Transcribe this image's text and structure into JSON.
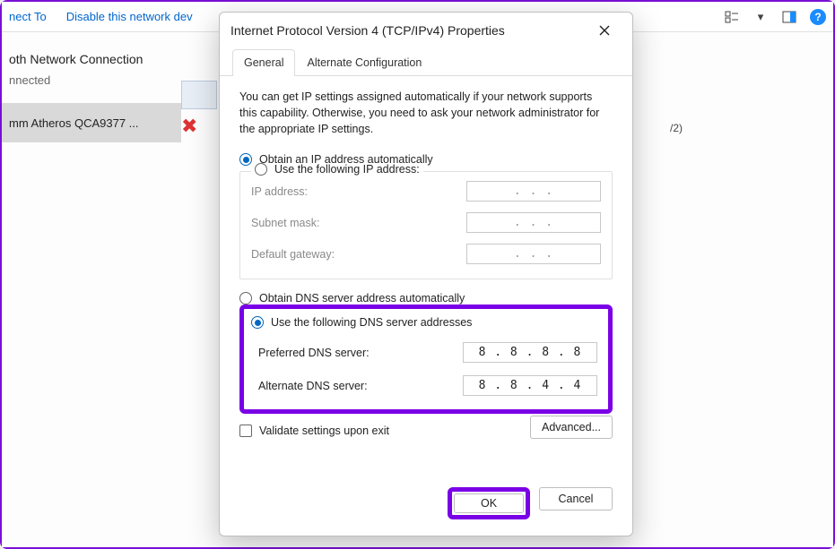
{
  "toolbar": {
    "connect_to": "nect To",
    "disable_label": "Disable this network dev",
    "help_char": "?"
  },
  "bg": {
    "conn_title": "oth Network Connection",
    "conn_status": "nnected",
    "selected_device": "mm Atheros QCA9377 ...",
    "lost_text": "/2)"
  },
  "dialog": {
    "title": "Internet Protocol Version 4 (TCP/IPv4) Properties",
    "tabs": {
      "general": "General",
      "alt": "Alternate Configuration"
    },
    "intro": "You can get IP settings assigned automatically if your network supports this capability. Otherwise, you need to ask your network administrator for the appropriate IP settings.",
    "ip": {
      "auto": "Obtain an IP address automatically",
      "manual": "Use the following IP address:",
      "addr_label": "IP address:",
      "mask_label": "Subnet mask:",
      "gw_label": "Default gateway:",
      "empty": ".     .     ."
    },
    "dns": {
      "auto": "Obtain DNS server address automatically",
      "manual": "Use the following DNS server addresses",
      "pref_label": "Preferred DNS server:",
      "alt_label": "Alternate DNS server:",
      "pref_value": "8 . 8 . 8 . 8",
      "alt_value": "8 . 8 . 4 . 4"
    },
    "validate": "Validate settings upon exit",
    "advanced": "Advanced...",
    "ok": "OK",
    "cancel": "Cancel"
  }
}
